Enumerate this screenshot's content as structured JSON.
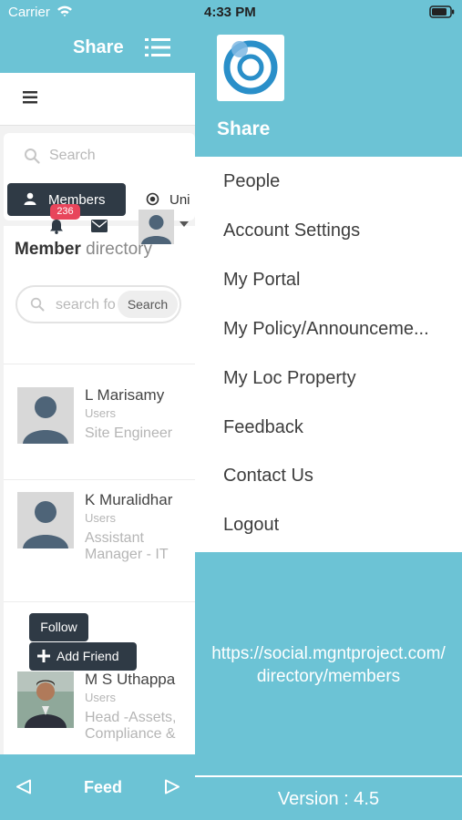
{
  "status": {
    "carrier": "Carrier",
    "time": "4:33 PM"
  },
  "left": {
    "title": "Share",
    "search_placeholder": "Search",
    "tabs": {
      "members": "Members",
      "unit": "Uni"
    },
    "badge_count": "236",
    "directory_title_bold": "Member",
    "directory_title_light": " directory",
    "directory_search_placeholder": "search fo",
    "directory_search_button": "Search",
    "members": [
      {
        "name": "L Marisamy",
        "role": "Users",
        "title": "Site Engineer"
      },
      {
        "name": "K Muralidhar",
        "role": "Users",
        "title": "Assistant Manager - IT"
      },
      {
        "name": "M S Uthappa",
        "role": "Users",
        "title": "Head -Assets, Compliance &"
      }
    ],
    "follow_label": "Follow",
    "add_friend_label": "Add Friend",
    "footer_label": "Feed"
  },
  "drawer": {
    "title": "Share",
    "menu": [
      "People",
      "Account Settings",
      "My Portal",
      "My Policy/Announceme...",
      "My Loc Property",
      "Feedback",
      "Contact Us",
      "Logout"
    ],
    "url": "https://social.mgntproject.com/ directory/members",
    "version": "Version : 4.5"
  },
  "colors": {
    "accent": "#6cc3d5",
    "dark": "#2f3a45",
    "badge": "#e8455b",
    "logo_blue": "#2a8fc9"
  }
}
